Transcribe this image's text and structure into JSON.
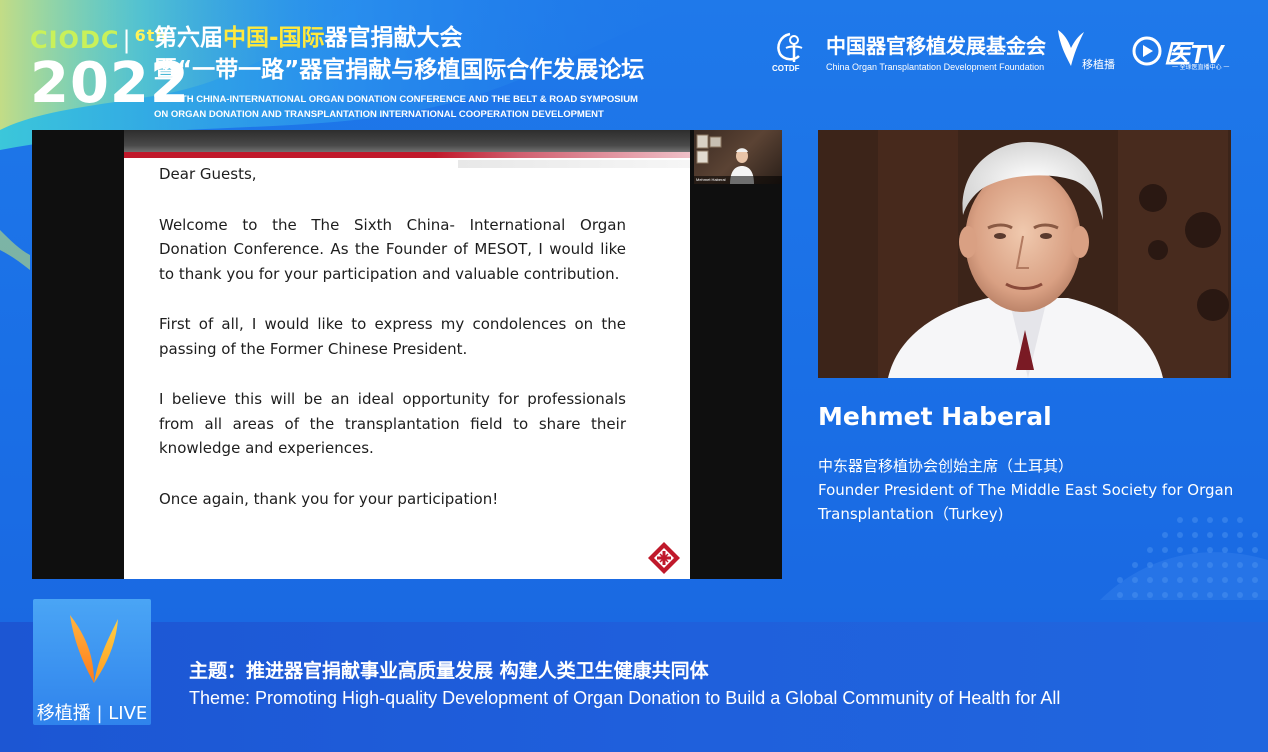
{
  "colors": {
    "background": "#1f79ea",
    "highlight_yellow": "#ffe93c",
    "brand_green": "#c9f15a",
    "slide_red": "#c0192b",
    "theme_bar": "#1f5fdc"
  },
  "header": {
    "brand_code": "CIODC",
    "brand_edition": "6th",
    "brand_year": "2022",
    "title_cn_line1_prefix": "第六届",
    "title_cn_line1_highlight": "中国-国际",
    "title_cn_line1_suffix": "器官捐献大会",
    "title_cn_line2": "暨“一带一路”器官捐献与移植国际合作发展论坛",
    "title_en_line1": "THE 6TH CHINA-INTERNATIONAL ORGAN DONATION CONFERENCE AND THE BELT & ROAD SYMPOSIUM",
    "title_en_line2": "ON ORGAN DONATION AND TRANSPLANTATION INTERNATIONAL COOPERATION DEVELOPMENT"
  },
  "logos": {
    "ciodf_code": "COTDF",
    "ciodf_cn": "中国器官移植发展基金会",
    "ciodf_en": "China Organ Transplantation Development Foundation",
    "yizhibo_label": "移植播",
    "yitv_label": "医TV",
    "yitv_sub": "一 全球医直播中心 一"
  },
  "slide": {
    "greeting": "Dear Guests,",
    "paragraph_1": "Welcome to the The Sixth China- International Organ Donation Conference. As the Founder of MESOT, I would like to thank you for your participation and valuable contribution.",
    "paragraph_2": "First of all, I would like to express my condolences on the passing of the Former Chinese President.",
    "paragraph_3": "I believe this will be an ideal opportunity for professionals from all areas of the transplantation field to share their knowledge and experiences.",
    "paragraph_4": "Once again, thank you for your participation!",
    "pip_label": "Mehmet Haberal"
  },
  "speaker": {
    "name": "Mehmet Haberal",
    "title_cn": "中东器官移植协会创始主席（土耳其）",
    "title_en": "Founder President of The Middle East Society for Organ Transplantation（Turkey)"
  },
  "theme": {
    "live_label": "移植播 | LIVE",
    "theme_cn": "主题：推进器官捐献事业高质量发展  构建人类卫生健康共同体",
    "theme_en": "Theme: Promoting High-quality Development of Organ Donation to Build a Global Community of Health for All"
  }
}
